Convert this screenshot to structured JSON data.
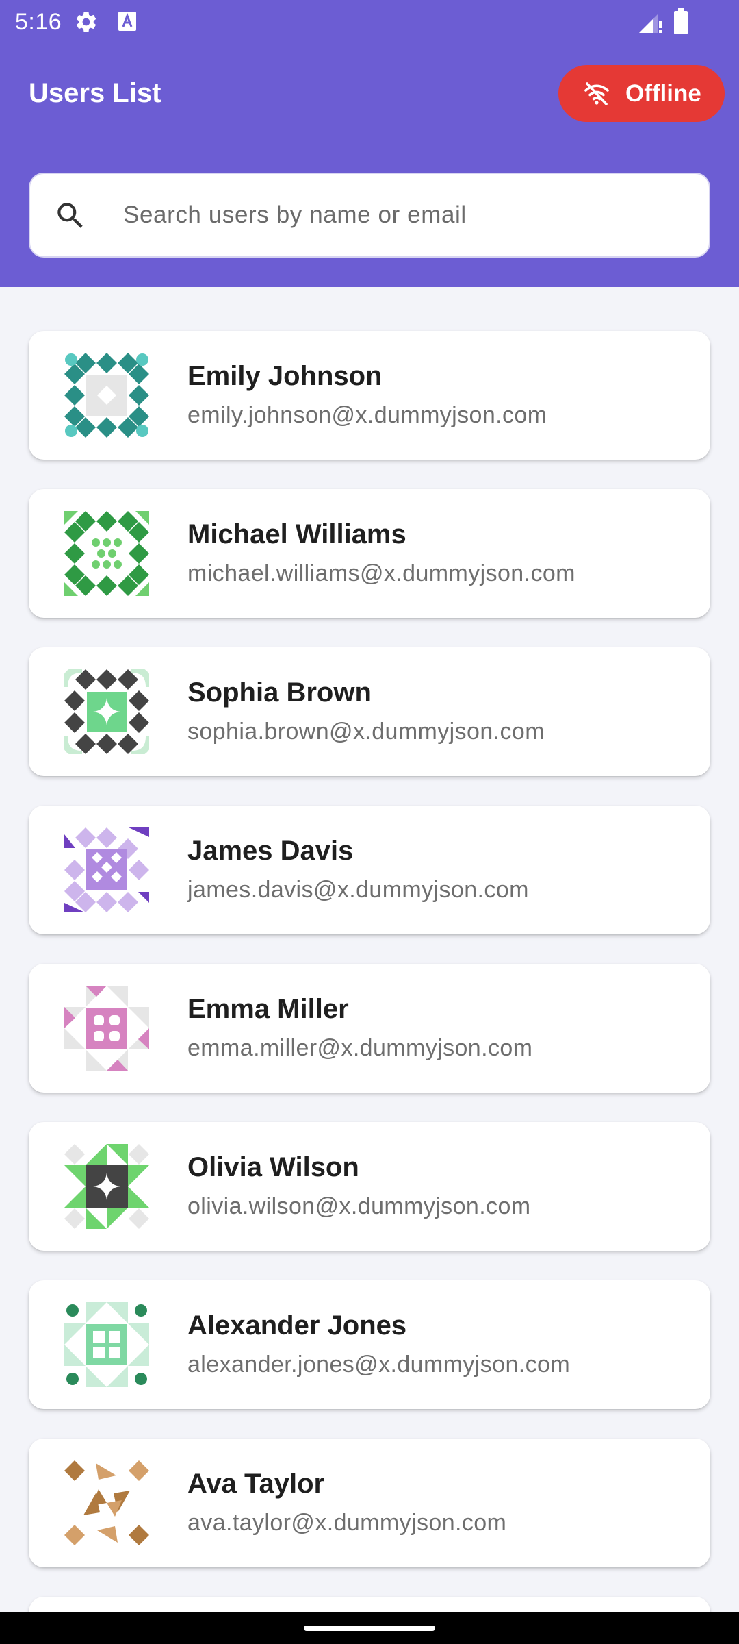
{
  "status_bar": {
    "time": "5:16",
    "icons": [
      "gear-icon",
      "app-notification-icon",
      "signal-icon",
      "battery-icon"
    ]
  },
  "header": {
    "title": "Users List",
    "offline_badge": {
      "label": "Offline",
      "icon": "wifi-off-icon",
      "color": "#e53935"
    },
    "background_color": "#6c5dd3"
  },
  "search": {
    "placeholder": "Search users by name or email",
    "value": "",
    "icon": "search-icon"
  },
  "users": [
    {
      "name": "Emily Johnson",
      "email": "emily.johnson@x.dummyjson.com",
      "avatar_colors": [
        "#2a8f86",
        "#58c8c0",
        "#e6e6e6"
      ]
    },
    {
      "name": "Michael Williams",
      "email": "michael.williams@x.dummyjson.com",
      "avatar_colors": [
        "#2f9a44",
        "#6fcf6f",
        "#ffffff"
      ]
    },
    {
      "name": "Sophia Brown",
      "email": "sophia.brown@x.dummyjson.com",
      "avatar_colors": [
        "#444444",
        "#6ed68c",
        "#c9ecd3"
      ]
    },
    {
      "name": "James Davis",
      "email": "james.davis@x.dummyjson.com",
      "avatar_colors": [
        "#6f3fc0",
        "#cdb5ec",
        "#ffffff"
      ]
    },
    {
      "name": "Emma Miller",
      "email": "emma.miller@x.dummyjson.com",
      "avatar_colors": [
        "#d683c0",
        "#e6e6e6",
        "#ffffff"
      ]
    },
    {
      "name": "Olivia Wilson",
      "email": "olivia.wilson@x.dummyjson.com",
      "avatar_colors": [
        "#444444",
        "#6ed46e",
        "#e6e6e6"
      ]
    },
    {
      "name": "Alexander Jones",
      "email": "alexander.jones@x.dummyjson.com",
      "avatar_colors": [
        "#2a8a5a",
        "#7fd8a3",
        "#c9ecd8"
      ]
    },
    {
      "name": "Ava Taylor",
      "email": "ava.taylor@x.dummyjson.com",
      "avatar_colors": [
        "#b07a3f",
        "#d4a06a",
        "#ffffff"
      ]
    }
  ]
}
